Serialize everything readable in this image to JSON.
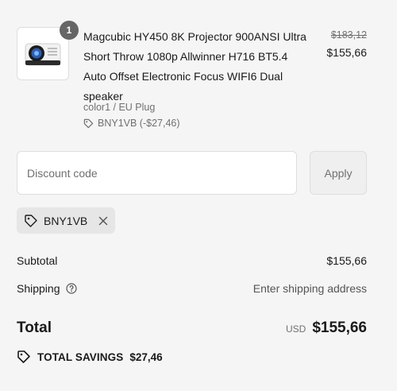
{
  "cart": {
    "item": {
      "quantity": "1",
      "image_icon": "projector-icon",
      "title": "Magcubic HY450 8K Projector 900ANSI Ultra Short Throw 1080p Allwinner H716 BT5.4 Auto Offset Electronic Focus WIFI6 Dual speaker",
      "variant": "color1 / EU Plug",
      "discount": "BNY1VB (-$27,46)",
      "price_original": "$183,12",
      "price_final": "$155,66"
    }
  },
  "discount": {
    "placeholder": "Discount code",
    "apply_label": "Apply",
    "applied_code": "BNY1VB"
  },
  "summary": {
    "subtotal_label": "Subtotal",
    "subtotal_value": "$155,66",
    "shipping_label": "Shipping",
    "shipping_value": "Enter shipping address",
    "total_label": "Total",
    "currency": "USD",
    "total_value": "$155,66",
    "savings_label": "TOTAL SAVINGS",
    "savings_value": "$27,46"
  },
  "colors": {
    "background": "#f5f5f5",
    "text": "#1a1a1a",
    "muted": "#707070",
    "border": "#dedede"
  }
}
